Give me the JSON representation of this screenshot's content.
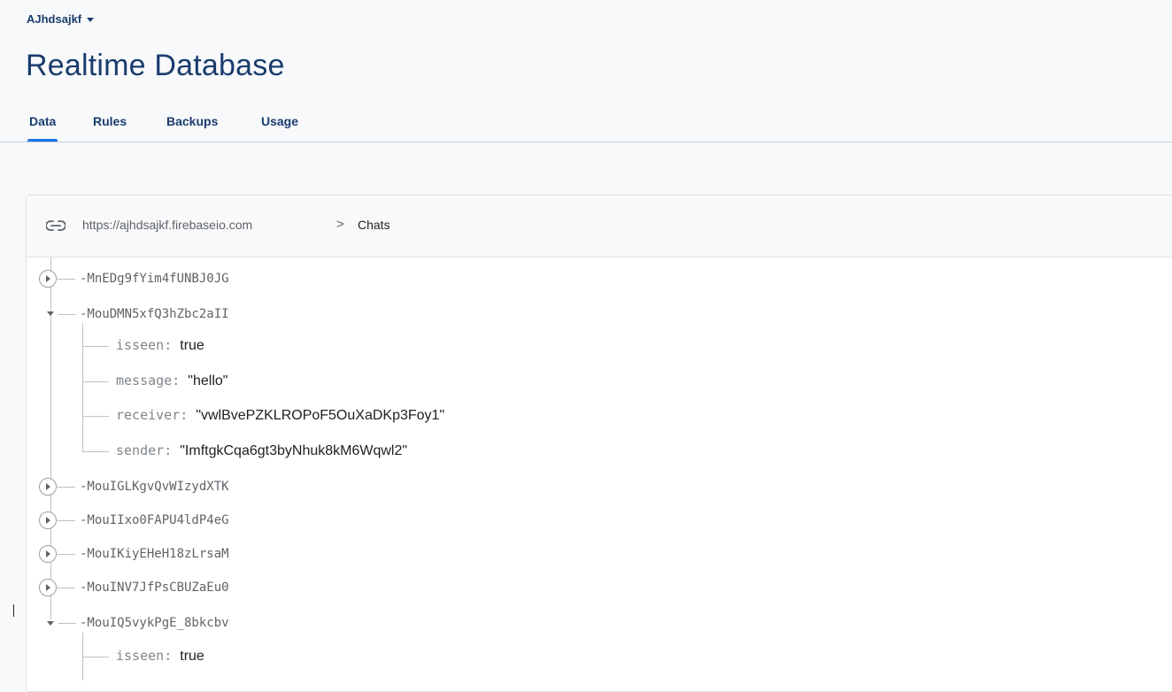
{
  "project": {
    "name": "AJhdsajkf"
  },
  "page": {
    "title": "Realtime Database"
  },
  "tabs": [
    {
      "label": "Data",
      "active": true
    },
    {
      "label": "Rules",
      "active": false
    },
    {
      "label": "Backups",
      "active": false
    },
    {
      "label": "Usage",
      "active": false
    }
  ],
  "urlbar": {
    "url": "https://ajhdsajkf.firebaseio.com",
    "separator": ">",
    "current": "Chats"
  },
  "tree": {
    "nodes": [
      {
        "key": "-MnEDg9fYim4fUNBJ0JG",
        "expanded": false
      },
      {
        "key": "-MouDMN5xfQ3hZbc2aII",
        "expanded": true,
        "children": [
          {
            "key": "isseen",
            "value": "true"
          },
          {
            "key": "message",
            "value": "\"hello\""
          },
          {
            "key": "receiver",
            "value": "\"vwlBvePZKLROPoF5OuXaDKp3Foy1\""
          },
          {
            "key": "sender",
            "value": "\"ImftgkCqa6gt3byNhuk8kM6Wqwl2\""
          }
        ]
      },
      {
        "key": "-MouIGLKgvQvWIzydXTK",
        "expanded": false
      },
      {
        "key": "-MouIIxo0FAPU4ldP4eG",
        "expanded": false
      },
      {
        "key": "-MouIKiyEHeH18zLrsaM",
        "expanded": false
      },
      {
        "key": "-MouINV7JfPsCBUZaEu0",
        "expanded": false
      },
      {
        "key": "-MouIQ5vykPgE_8bkcbv",
        "expanded": true,
        "children": [
          {
            "key": "isseen",
            "value": "true"
          }
        ]
      }
    ]
  },
  "colors": {
    "accent": "#1a73e8",
    "title": "#1a3c6e"
  }
}
